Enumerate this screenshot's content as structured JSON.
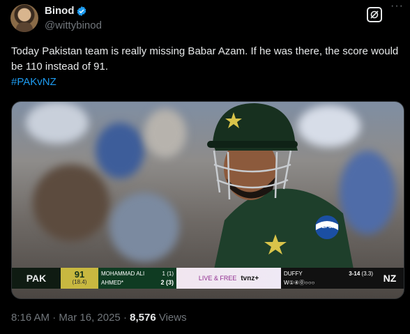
{
  "author": {
    "name": "Binod",
    "handle": "@wittybinod"
  },
  "post": {
    "text": "Today Pakistan team is really missing Babar Azam. If he was there, the score would be 110 instead of 91.",
    "hashtag": "#PAKvNZ",
    "time": "8:16 AM",
    "date": "Mar 16, 2025",
    "views_count": "8,576",
    "views_label": "Views"
  },
  "scoreboard": {
    "team_left": "PAK",
    "score": "91",
    "overs": "(18.4)",
    "batter1_name": "MOHAMMAD ALI",
    "batter1_score": "1 (1)",
    "batter2_name": "AHMED*",
    "batter2_score": "2 (3)",
    "live_text": "LIVE & FREE",
    "broadcaster": "tvnz+",
    "bowler_name": "DUFFY",
    "bowler_figures": "3-14",
    "bowler_overs": "(3.3)",
    "balls": "W①④⓪○○○",
    "team_right": "NZ"
  },
  "jersey_sponsor": "PEPSI",
  "colors": {
    "background": "#000000",
    "text": "#e7e9ea",
    "muted": "#71767b",
    "link": "#1d9bf0",
    "verified": "#1d9bf0"
  }
}
